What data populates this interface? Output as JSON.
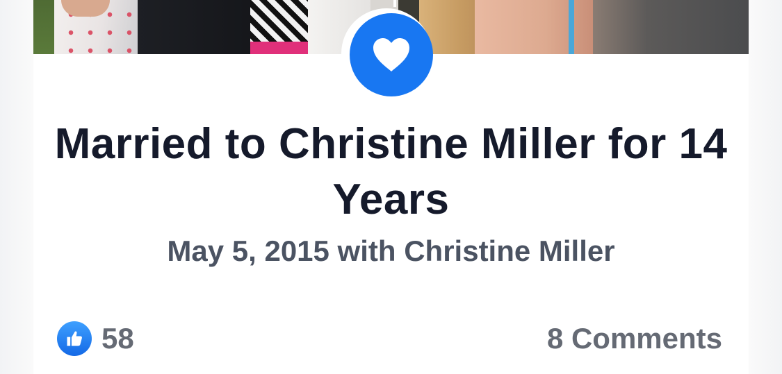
{
  "post": {
    "title": "Married to Christine Miller for 14 Years",
    "subtitle": "May 5, 2015 with Christine Miller",
    "badge_icon": "heart-icon",
    "accent_color": "#1877f2"
  },
  "reactions": {
    "icon": "thumbs-up-icon",
    "like_count": "58",
    "comments_label": "8 Comments"
  }
}
